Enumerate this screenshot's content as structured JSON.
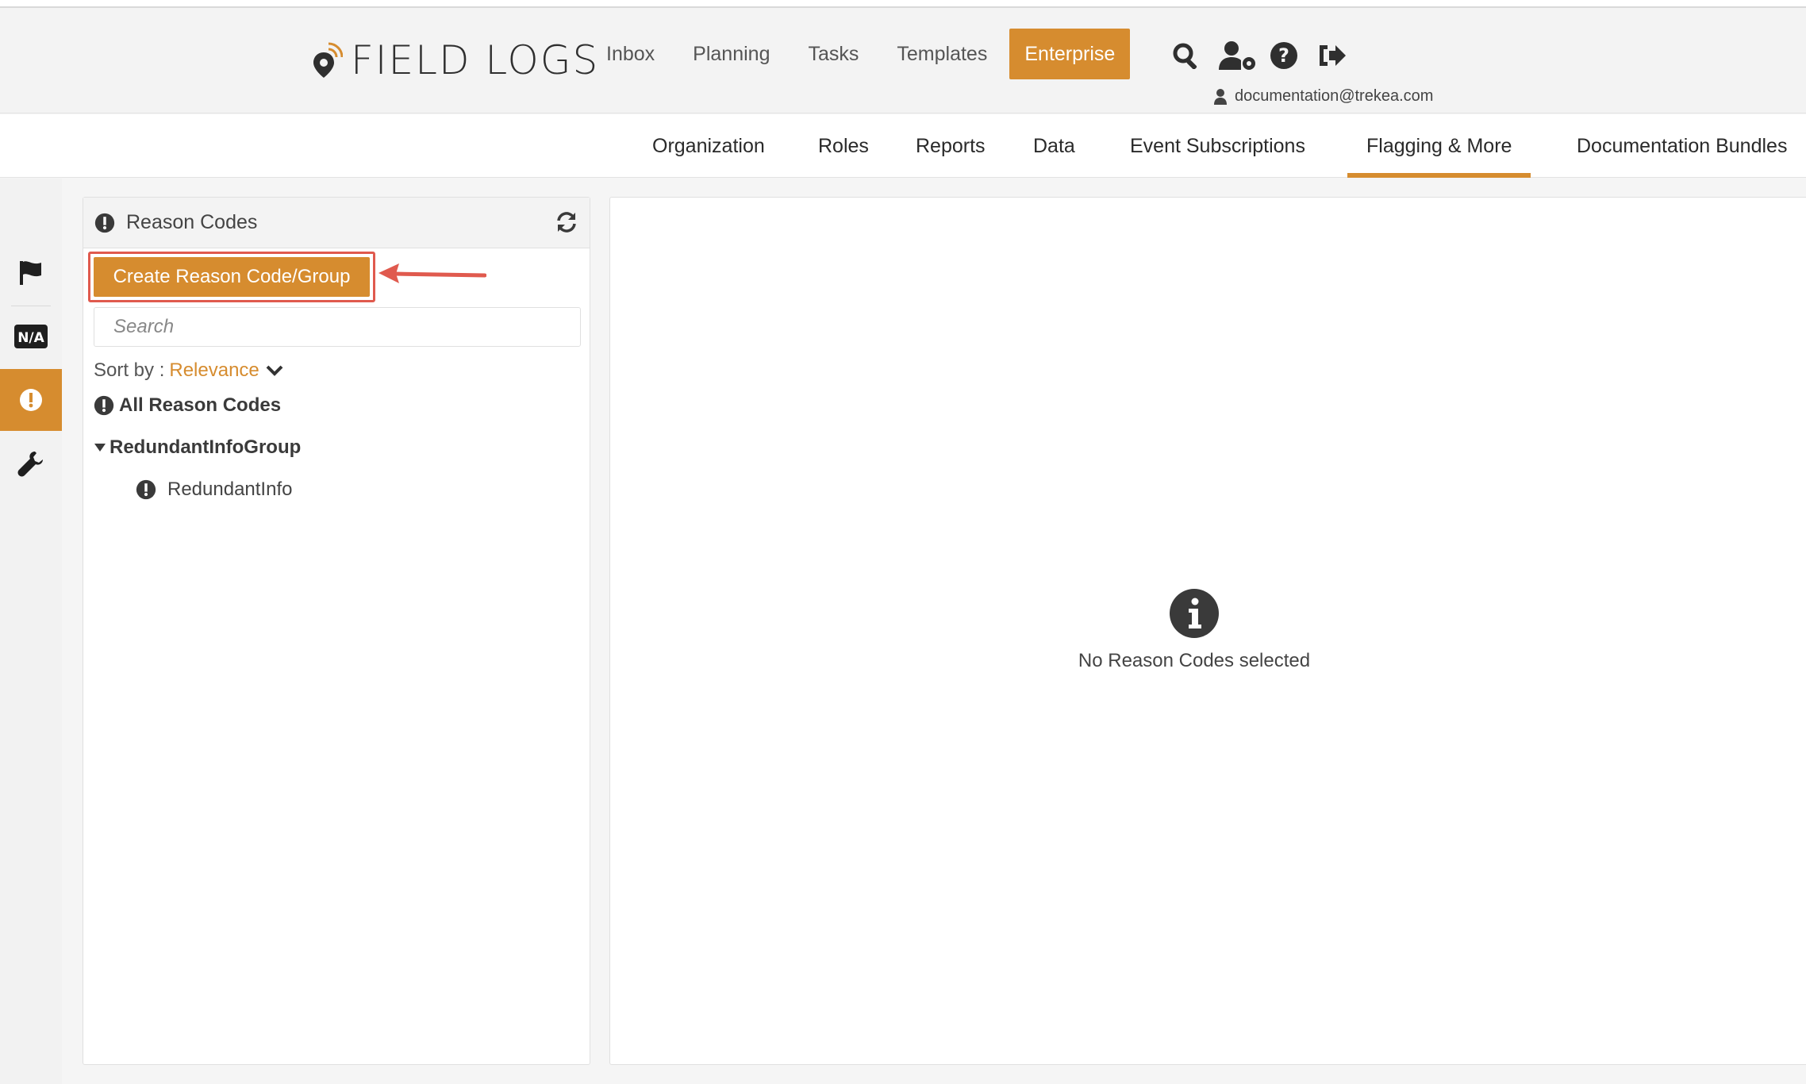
{
  "brand": {
    "name": "FIELD LOGS",
    "accent": "#d68c2f"
  },
  "nav": {
    "items": [
      "Inbox",
      "Planning",
      "Tasks",
      "Templates"
    ],
    "enterprise_label": "Enterprise",
    "user_email": "documentation@trekea.com"
  },
  "tabs": [
    "Organization",
    "Roles",
    "Reports",
    "Data",
    "Event Subscriptions",
    "Flagging & More",
    "Documentation Bundles"
  ],
  "active_tab": "Flagging & More",
  "rail": {
    "items": [
      "flag-icon",
      "na-icon",
      "exclamation-icon",
      "wrench-icon"
    ],
    "active": "exclamation-icon"
  },
  "panel": {
    "title": "Reason Codes",
    "create_label": "Create Reason Code/Group",
    "search_placeholder": "Search",
    "sort_label": "Sort by :",
    "sort_value": "Relevance",
    "all_label": "All Reason Codes",
    "group_label": "RedundantInfoGroup",
    "child_label": "RedundantInfo"
  },
  "detail": {
    "empty_text": "No Reason Codes selected"
  }
}
